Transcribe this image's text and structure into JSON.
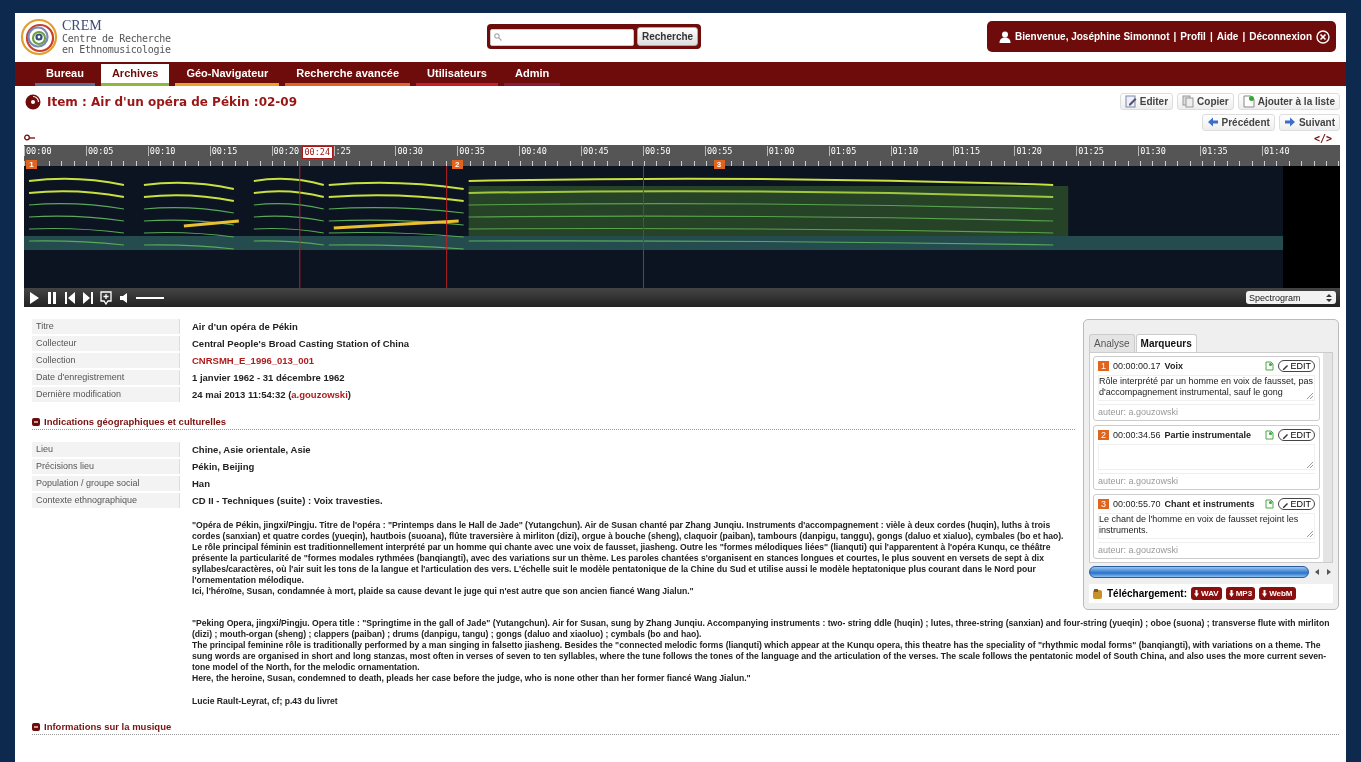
{
  "logo": {
    "name": "CREM",
    "subtitle_lines": [
      "Centre de Recherche",
      "en Ethnomusicologie"
    ]
  },
  "search": {
    "button": "Recherche"
  },
  "user_bar": {
    "items": [
      {
        "kind": "user",
        "text": "Bienvenue, Joséphine Simonnot"
      },
      {
        "kind": "separator",
        "text": "|"
      },
      {
        "kind": "link",
        "text": "Profil"
      },
      {
        "kind": "separator",
        "text": "|"
      },
      {
        "kind": "link",
        "text": "Aide"
      },
      {
        "kind": "separator",
        "text": "|"
      },
      {
        "kind": "logout",
        "text": "Déconnexion"
      }
    ]
  },
  "nav": {
    "tabs": [
      {
        "label": "Bureau",
        "selected": false,
        "color": "#5a6f96"
      },
      {
        "label": "Archives",
        "selected": true,
        "color": "#8db83a"
      },
      {
        "label": "Géo-Navigateur",
        "selected": false,
        "color": "#e9a32b"
      },
      {
        "label": "Recherche avancée",
        "selected": false,
        "color": "#e0642a"
      },
      {
        "label": "Utilisateurs",
        "selected": false,
        "color": "#c8202a"
      },
      {
        "label": "Admin",
        "selected": false,
        "color": "#8a1a3a"
      }
    ]
  },
  "item": {
    "title": "Item : Air d'un opéra de Pékin :02-09",
    "actions": [
      {
        "kind": "edit",
        "label": "Editer"
      },
      {
        "kind": "copy",
        "label": "Copier"
      },
      {
        "kind": "add",
        "label": "Ajouter à la liste"
      }
    ],
    "navigation": [
      {
        "kind": "prev",
        "label": "Précédent"
      },
      {
        "kind": "next",
        "label": "Suivant"
      }
    ]
  },
  "player": {
    "embed_label": "</>",
    "ticks": [
      "00:00",
      "00:05",
      "00:10",
      "00:15",
      "00:20",
      ":25",
      "00:30",
      "00:35",
      "00:40",
      "00:45",
      "00:50",
      "00:55",
      "01:00",
      "01:05",
      "01:10",
      "01:15",
      "01:20",
      "01:25",
      "01:30",
      "01:35",
      "01:40"
    ],
    "cursor": "00:24",
    "markers": [
      "1",
      "2",
      "3"
    ],
    "volume": {
      "level": 1
    },
    "view_select": "Spectrogram"
  },
  "metadata": [
    {
      "label": "Titre",
      "value": "Air d'un opéra de Pékin"
    },
    {
      "label": "Collecteur",
      "value": "Central People's Broad Casting Station of China"
    },
    {
      "label": "Collection",
      "kind": "link",
      "value": "CNRSMH_E_1996_013_001"
    },
    {
      "label": "Date d'enregistrement",
      "value": "1 janvier 1962 - 31 décembre 1962"
    },
    {
      "label": "Dernière modification",
      "kind": "with_link",
      "value": "24 mai 2013 11:54:32 (",
      "link": "a.gouzowski",
      "after": ")"
    }
  ],
  "sections": [
    {
      "title": "Indications géographiques et culturelles",
      "fields": [
        {
          "label": "Lieu",
          "value": "Chine, Asie orientale, Asie"
        },
        {
          "label": "Précisions lieu",
          "value": "Pékin, Beijing"
        },
        {
          "label": "Population / groupe social",
          "value": "Han"
        },
        {
          "label": "Contexte ethnographique",
          "value": "CD II - Techniques (suite) : Voix travesties.",
          "paragraphs": [
            [
              "\"Opéra de Pékin, jingxi/Pingju. Titre de l'opéra : \"Printemps dans le Hall de Jade\" (Yutangchun). Air de Susan chanté par Zhang Junqiu. Instruments d'accompagnement : vièle à deux cordes (huqin), luths à trois cordes (sanxian) et quatre cordes (yueqin), hautbois (suoana), flûte traversière à mirliton (dizi), orgue à bouche (sheng), claquoir (paiban), tambours (danpigu, tanggu), gongs (daluo et xialuo), cymbales (bo et hao).",
              "Le rôle principal féminin est traditionnellement interprété par un homme qui chante avec une voix de fausset, jiasheng. Outre les \"formes mélodiques liées\" (lianquti) qui l'apparentent à l'opéra Kunqu, ce théâtre présente la particularité de \"formes modales rythmées (banqiangti), avec des variations sur un thème. Les paroles chantées s'organisent en stances longues et courtes, le plus souvent en versets de sept à dix syllabes/caractères, où l'air suit les tons de la langue et l'articulation des vers. L'échelle suit le modèle pentatonique de la Chine du Sud et utilise aussi le modèle heptatonique plus courant dans le Nord pour l'ornementation mélodique.",
              "Ici, l'héroïne, Susan, condamnée à mort, plaide sa cause devant le juge qui n'est autre que son ancien fiancé Wang Jialun.\""
            ],
            [
              "\"Peking Opera, jingxi/Pingju. Opera title : \"Springtime in the gall of Jade\" (Yutangchun). Air for Susan, sung by Zhang Junqiu. Accompanying instruments : two- string ddle (huqin) ; lutes, three-string (sanxian) and four-string (yueqin) ; oboe (suona) ; transverse flute with mirliton (dizi) ; mouth-organ (sheng) ; clappers (paiban) ; drums (danpigu, tangu) ; gongs (daluo and xiaoluo) ; cymbals (bo and hao).",
              "The principal feminine rôle is traditionally performed by a man singing in falsetto jiasheng. Besides the \"connected melodic forms (lianquti) which appear at the Kunqu opera, this theatre has the speciality of \"rhythmic modal forms\" (banqiangti), with variations on a theme. The sung words are organised in short and long stanzas, most often in verses of seven to ten syllables, where the tune follows the tones of the language and the articulation of the verses. The scale follows the pentatonic model of South China, and also uses the more current seven-tone model of the North, for the melodic ornamentation.",
              "Here, the heroine, Susan, condemned to death, pleads her case before the judge, who is none other than her former fiancé Wang Jialun.\""
            ],
            [
              "Lucie Rault-Leyrat, cf; p.43 du livret"
            ]
          ]
        }
      ]
    },
    {
      "title": "Informations sur la musique"
    }
  ],
  "panel": {
    "tabs": [
      {
        "label": "Analyse",
        "selected": false
      },
      {
        "label": "Marqueurs",
        "selected": true
      }
    ],
    "markers": [
      {
        "number": "1",
        "time": "00:00:00.17",
        "title": "Voix",
        "edit": "EDIT",
        "description": "Rôle interprété par un homme en voix de fausset, pas d'accompagnement instrumental, sauf le gong",
        "author": "auteur: a.gouzowski"
      },
      {
        "number": "2",
        "time": "00:00:34.56",
        "title": "Partie instrumentale",
        "edit": "EDIT",
        "author": "auteur: a.gouzowski"
      },
      {
        "number": "3",
        "time": "00:00:55.70",
        "title": "Chant et instruments",
        "edit": "EDIT",
        "description": "Le chant de l'homme en voix de fausset rejoint les instruments.",
        "author": "auteur: a.gouzowski"
      }
    ],
    "download": {
      "label": "Téléchargement:",
      "formats": [
        "WAV",
        "MP3",
        "WebM"
      ]
    }
  }
}
